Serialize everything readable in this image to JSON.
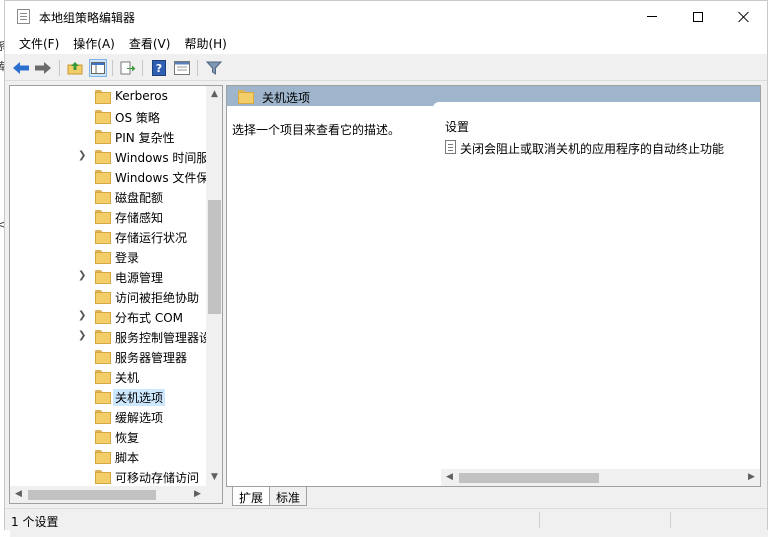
{
  "window": {
    "title": "本地组策略编辑器"
  },
  "menu": [
    "文件(F)",
    "操作(A)",
    "查看(V)",
    "帮助(H)"
  ],
  "toolbar": {
    "icons": [
      "back-arrow-icon",
      "forward-arrow-icon",
      "up-folder-icon",
      "show-hide-tree-icon",
      "export-list-icon",
      "help-icon",
      "properties-icon",
      "filter-icon"
    ]
  },
  "behind_fragments": [
    "系",
    "库",
    "<"
  ],
  "tree": {
    "items": [
      {
        "label": "Kerberos",
        "expandable": false,
        "selected": false
      },
      {
        "label": "OS 策略",
        "expandable": false,
        "selected": false
      },
      {
        "label": "PIN 复杂性",
        "expandable": false,
        "selected": false
      },
      {
        "label": "Windows 时间服",
        "expandable": true,
        "selected": false
      },
      {
        "label": "Windows 文件保",
        "expandable": false,
        "selected": false
      },
      {
        "label": "磁盘配额",
        "expandable": false,
        "selected": false
      },
      {
        "label": "存储感知",
        "expandable": false,
        "selected": false
      },
      {
        "label": "存储运行状况",
        "expandable": false,
        "selected": false
      },
      {
        "label": "登录",
        "expandable": false,
        "selected": false
      },
      {
        "label": "电源管理",
        "expandable": true,
        "selected": false
      },
      {
        "label": "访问被拒绝协助",
        "expandable": false,
        "selected": false
      },
      {
        "label": "分布式 COM",
        "expandable": true,
        "selected": false
      },
      {
        "label": "服务控制管理器设",
        "expandable": true,
        "selected": false
      },
      {
        "label": "服务器管理器",
        "expandable": false,
        "selected": false
      },
      {
        "label": "关机",
        "expandable": false,
        "selected": false
      },
      {
        "label": "关机选项",
        "expandable": false,
        "selected": true
      },
      {
        "label": "缓解选项",
        "expandable": false,
        "selected": false
      },
      {
        "label": "恢复",
        "expandable": false,
        "selected": false
      },
      {
        "label": "脚本",
        "expandable": false,
        "selected": false
      },
      {
        "label": "可移动存储访问",
        "expandable": false,
        "selected": false
      }
    ]
  },
  "right_pane": {
    "header": "关机选项",
    "description": "选择一个项目来查看它的描述。",
    "column_header": "设置",
    "policies": [
      "关闭会阻止或取消关机的应用程序的自动终止功能"
    ]
  },
  "tabs": [
    "扩展",
    "标准"
  ],
  "status": {
    "text": "1 个设置"
  },
  "colors": {
    "header_bg": "#9fb5cc",
    "selection_bg": "#cce8ff",
    "folder_yellow": "#f2cd68"
  }
}
